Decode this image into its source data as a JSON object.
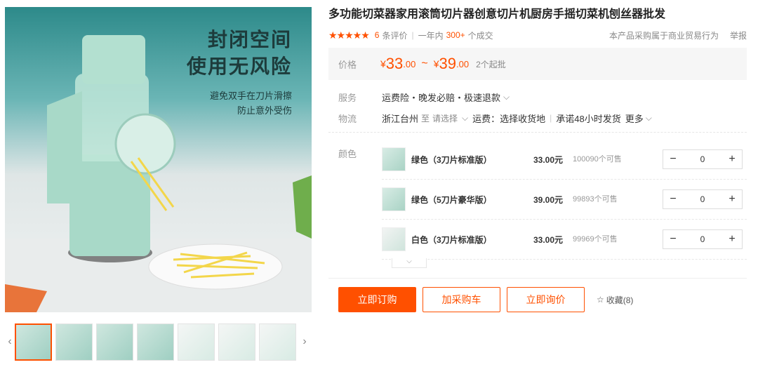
{
  "gallery": {
    "headline_line1": "封闭空间",
    "headline_line2": "使用无风险",
    "sub_line1": "避免双手在刀片滑擦",
    "sub_line2": "防止意外受伤",
    "prev_arrow": "‹",
    "next_arrow": "›",
    "thumb_count": 7
  },
  "product": {
    "title": "多功能切菜器家用滚筒切片器创意切片机厨房手摇切菜机刨丝器批发",
    "stars": "★★★★★",
    "review_count": "6",
    "review_label": "条评价",
    "sales_prefix": "一年内",
    "sales_count": "300+",
    "sales_suffix": "个成交",
    "note": "本产品采购属于商业贸易行为",
    "report": "举报"
  },
  "price": {
    "label": "价格",
    "currency": "¥",
    "low_int": "33",
    "low_dec": ".00",
    "sep": "~",
    "high_int": "39",
    "high_dec": ".00",
    "moq": "2个起批"
  },
  "service": {
    "label": "服务",
    "text": "运费险・晚发必赔・极速退款",
    "chevron": "⌵"
  },
  "logistics": {
    "label": "物流",
    "origin": "浙江台州",
    "to": "至",
    "select": "请选择",
    "chevron": "⌵",
    "freight": "运费：选择收货地",
    "promise": "承诺48小时发货",
    "more": "更多"
  },
  "variants": {
    "label": "颜色",
    "items": [
      {
        "name": "绿色（3刀片标准版）",
        "price": "33.00元",
        "stock": "100090个可售",
        "qty": "0"
      },
      {
        "name": "绿色（5刀片豪华版）",
        "price": "39.00元",
        "stock": "99893个可售",
        "qty": "0"
      },
      {
        "name": "白色（3刀片标准版）",
        "price": "33.00元",
        "stock": "99969个可售",
        "qty": "0"
      }
    ],
    "minus": "−",
    "plus": "+",
    "expand": "⌵"
  },
  "actions": {
    "buy": "立即订购",
    "cart": "加采购车",
    "ask": "立即询价",
    "fav_icon": "☆",
    "fav": "收藏(8)"
  },
  "colors": {
    "accent": "#ff5000",
    "price_bg": "#f6f6f6"
  }
}
